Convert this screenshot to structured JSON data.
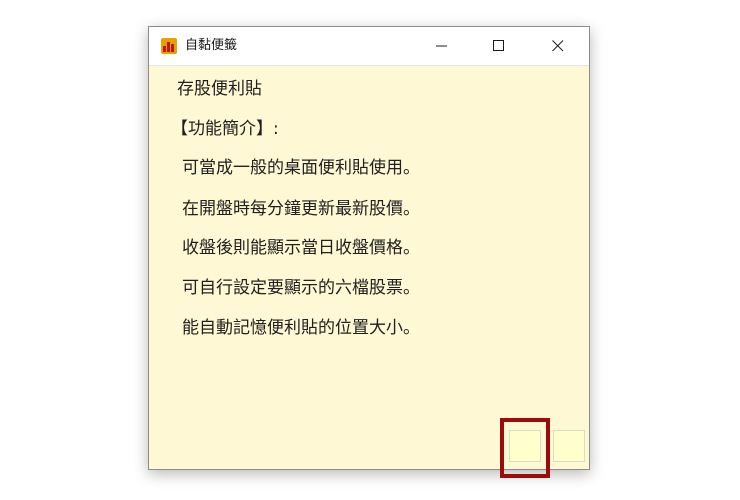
{
  "window": {
    "title": "自黏便籤",
    "app_icon": "stock-chart-icon",
    "controls": {
      "minimize": "minimize-icon",
      "maximize": "maximize-icon",
      "close": "close-icon"
    }
  },
  "note": {
    "title": "存股便利貼",
    "section_title": "【功能簡介】:",
    "features": [
      "可當成一般的桌面便利貼使用。",
      "在開盤時每分鐘更新最新股價。",
      "收盤後則能顯示當日收盤價格。",
      "可自行設定要顯示的六檔股票。",
      "能自動記憶便利貼的位置大小。"
    ]
  },
  "colors": {
    "note_background": "#fff8d4",
    "swatch": "#ffffcc",
    "highlight": "#9b0b0b"
  }
}
